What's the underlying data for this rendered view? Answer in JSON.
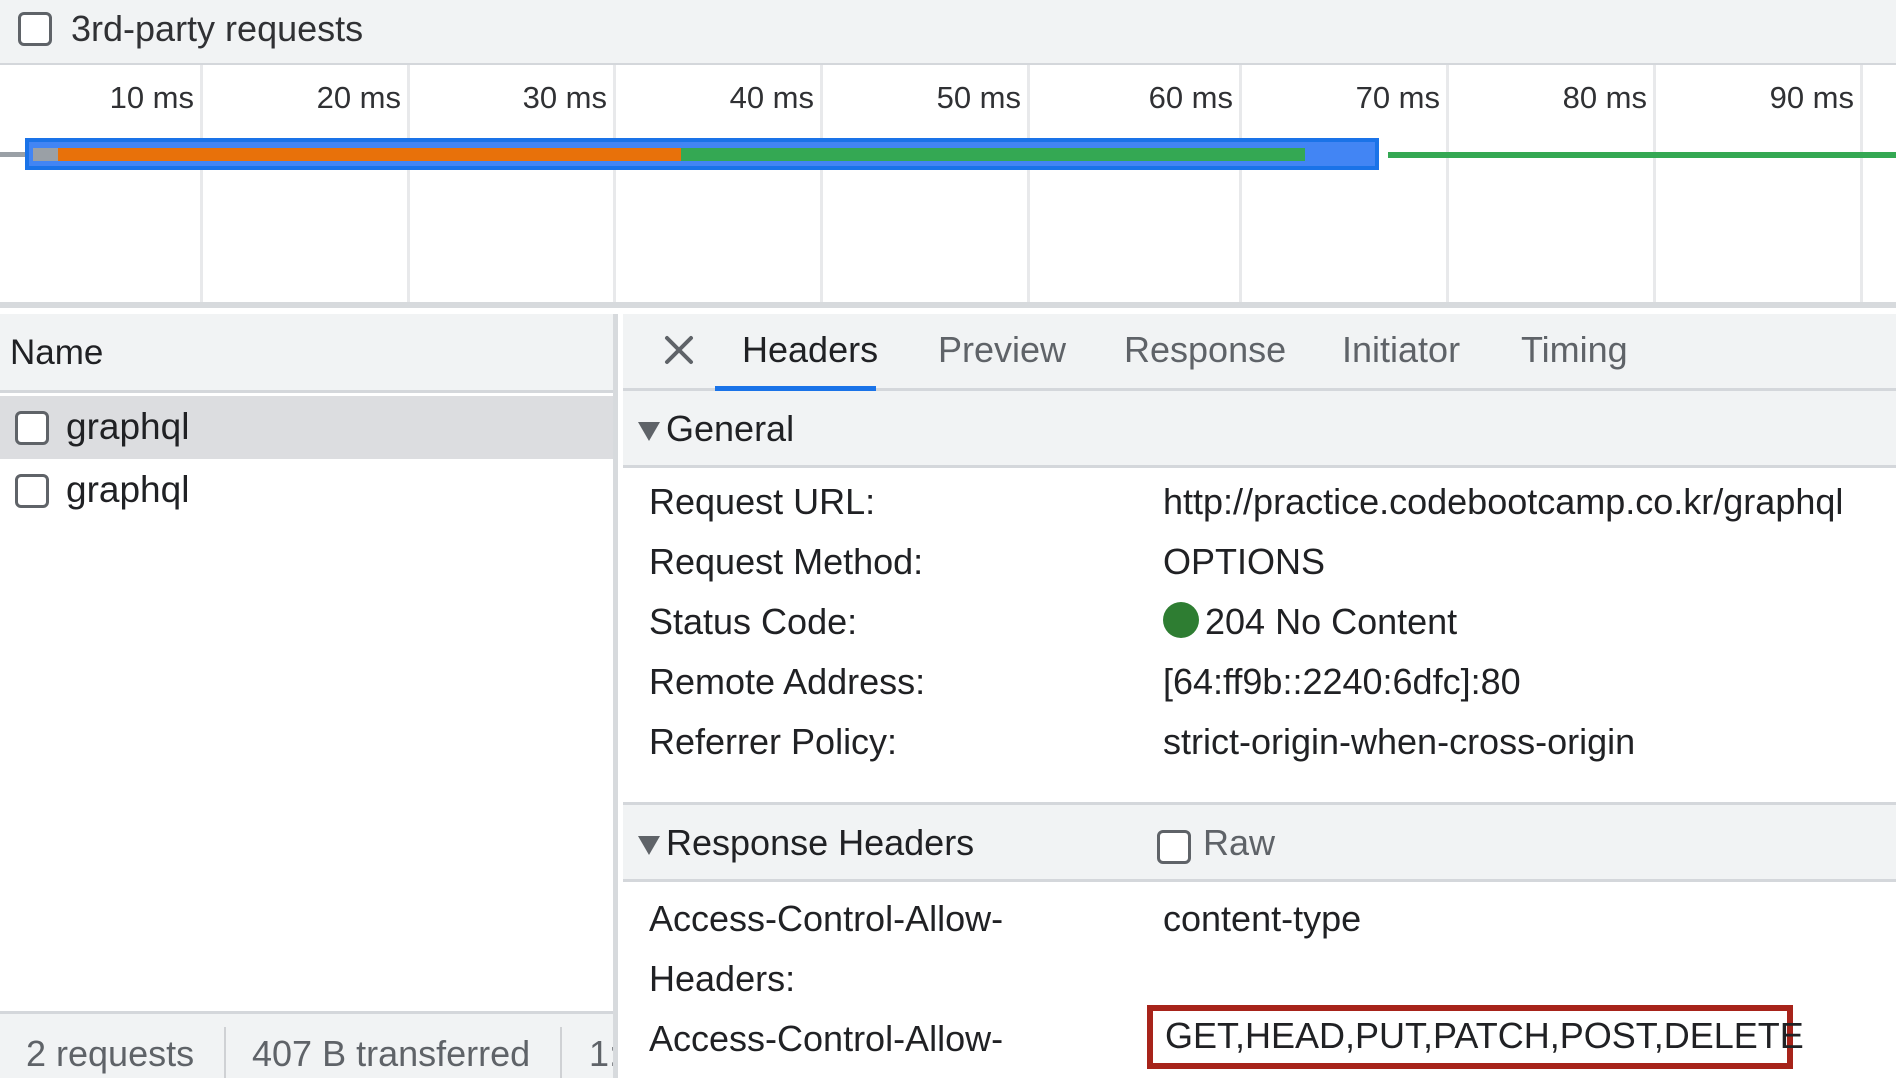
{
  "filter_bar": {
    "third_party_label": "3rd-party requests",
    "third_party_checked": false
  },
  "timeline": {
    "ticks": [
      "10 ms",
      "20 ms",
      "30 ms",
      "40 ms",
      "50 ms",
      "60 ms",
      "70 ms",
      "80 ms",
      "90 ms"
    ],
    "bar_colors": {
      "queue": "#9aa0a6",
      "waiting": "#e8710a",
      "download": "#34a853",
      "selection": "#1a73e8"
    }
  },
  "requests": {
    "header": "Name",
    "items": [
      {
        "name": "graphql",
        "selected": true
      },
      {
        "name": "graphql",
        "selected": false
      }
    ],
    "status": {
      "count": "2 requests",
      "transferred": "407 B transferred",
      "truncated": "1:"
    }
  },
  "details": {
    "tabs": [
      "Headers",
      "Preview",
      "Response",
      "Initiator",
      "Timing"
    ],
    "active_tab": "Headers",
    "general": {
      "title": "General",
      "request_url_label": "Request URL:",
      "request_url": "http://practice.codebootcamp.co.kr/graphql",
      "method_label": "Request Method:",
      "method": "OPTIONS",
      "status_label": "Status Code:",
      "status": "204 No Content",
      "status_color": "#2e7d32",
      "remote_label": "Remote Address:",
      "remote": "[64:ff9b::2240:6dfc]:80",
      "referrer_label": "Referrer Policy:",
      "referrer": "strict-origin-when-cross-origin"
    },
    "response_headers": {
      "title": "Response Headers",
      "raw_label": "Raw",
      "raw_checked": false,
      "allow_headers_label_1": "Access-Control-Allow-",
      "allow_headers_label_2": "Headers:",
      "allow_headers_value": "content-type",
      "allow_methods_label": "Access-Control-Allow-",
      "allow_methods_value": "GET,HEAD,PUT,PATCH,POST,DELETE",
      "highlight_color": "#a7231a"
    }
  }
}
